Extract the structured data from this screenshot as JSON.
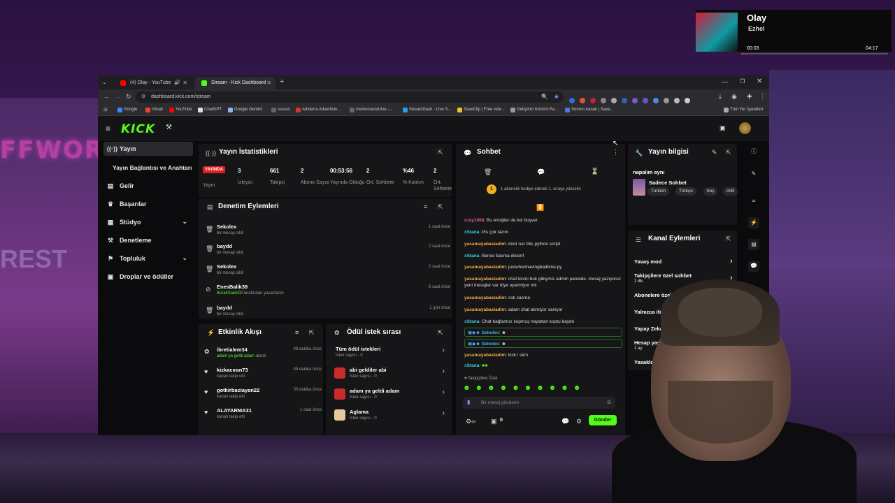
{
  "youtube_pip": {
    "title": "Olay",
    "artist": "Ezhel",
    "time_current": "00:03",
    "time_total": "04:17",
    "progress": 0.012
  },
  "browser": {
    "tabs": [
      {
        "label": "(4) Olay - YouTube",
        "active": false,
        "color": "#ff0000"
      },
      {
        "label": "Stream - Kick Dashboard",
        "active": true,
        "color": "#53fc18"
      }
    ],
    "url": "dashboard.kick.com/stream",
    "bookmarks": [
      "Google",
      "Gmail",
      "YouTube",
      "ChatGPT",
      "Google Gemini",
      "ssssss",
      "Adsterra Advertisin...",
      "memesound.live -...",
      "StreamDash - Live S...",
      "SaveClip | Free vide...",
      "Geliştirici Kontrol Pa...",
      "Sonrım kanalı | Save..."
    ],
    "bookmarks_all": "Tüm Yer İşaretleri"
  },
  "kick": {
    "logo": "KICK",
    "sidebar": [
      {
        "label": "Yayın",
        "icon": "broadcast-icon",
        "active": true
      },
      {
        "label": "Yayın Bağlantısı ve Anahtarı",
        "icon": "",
        "active": false
      },
      {
        "label": "Gelir",
        "icon": "wallet-icon",
        "active": false
      },
      {
        "label": "Başarılar",
        "icon": "trophy-icon",
        "active": false
      },
      {
        "label": "Stüdyo",
        "icon": "studio-icon",
        "active": false,
        "chevron": true
      },
      {
        "label": "Denetleme",
        "icon": "hammer-icon",
        "active": false
      },
      {
        "label": "Topluluk",
        "icon": "community-icon",
        "active": false,
        "chevron": true
      },
      {
        "label": "Droplar ve ödüller",
        "icon": "gift-icon",
        "active": false
      }
    ],
    "stats": {
      "title": "Yayın İstatistikleri",
      "live_badge": "YAYINDA",
      "items": [
        {
          "value": "",
          "label": "Yayın"
        },
        {
          "value": "3",
          "label": "İzleyici"
        },
        {
          "value": "661",
          "label": "Takipçi"
        },
        {
          "value": "2",
          "label": "Abone Sayısı"
        },
        {
          "value": "00:53:56",
          "label": "Yayında Olduğu"
        },
        {
          "value": "2",
          "label": "Ort. Sohbete"
        },
        {
          "value": "%46",
          "label": "% Katılım"
        },
        {
          "value": "2",
          "label": "Ort. Sohbete"
        }
      ]
    },
    "moderation": {
      "title": "Denetim Eylemleri",
      "rows": [
        {
          "name": "Sekolex",
          "sub": "bir mesajı sildi",
          "time": "1 saat önce",
          "icon": "trash-icon"
        },
        {
          "name": "baydd",
          "sub": "bir mesajı sildi",
          "time": "2 saat önce",
          "icon": "trash-icon"
        },
        {
          "name": "Sekolex",
          "sub": "bir mesajı sildi",
          "time": "2 saat önce",
          "icon": "trash-icon"
        },
        {
          "name": "EnesBalik39",
          "sub_user": "BurakSakinOl",
          "sub": "tarafından yasaklandı",
          "time": "6 saat önce",
          "icon": "ban-icon"
        },
        {
          "name": "baydd",
          "sub": "bir mesajı sildi",
          "time": "1 gün önce",
          "icon": "trash-icon"
        }
      ]
    },
    "activity": {
      "title": "Etkinlik Akışı",
      "rows": [
        {
          "name": "ibretialem34",
          "sub_hl": "adam ya geldi adam",
          "sub": "alındı",
          "time": "48 dakika önce",
          "icon": "reward-icon"
        },
        {
          "name": "kizkacıran73",
          "sub": "kanalı takip etti",
          "time": "49 dakika önce",
          "icon": "heart-icon"
        },
        {
          "name": "gotkirbaciayan22",
          "sub": "kanalı takip etti",
          "time": "50 dakika önce",
          "icon": "heart-icon"
        },
        {
          "name": "ALAYARMA31",
          "sub": "kanalı takip etti",
          "time": "1 saat önce",
          "icon": "heart-icon"
        }
      ]
    },
    "rewards": {
      "title": "Ödül istek sırası",
      "rows": [
        {
          "name": "Tüm ödül istekleri",
          "sub": "İstek sayısı - 0",
          "color": ""
        },
        {
          "name": "abi geldiler abi",
          "sub": "İstek sayısı - 0",
          "color": "#c92a2a"
        },
        {
          "name": "adam ya geldi adam",
          "sub": "İstek sayısı - 0",
          "color": "#c92a2a"
        },
        {
          "name": "Aglama",
          "sub": "İstek sayısı - 0",
          "color": "#e6c89a"
        }
      ]
    },
    "chat": {
      "title": "Sohbet",
      "gift_banner": "1 aboneilk hediye ederek 1. sıraya yükselin",
      "gift_rank": "1",
      "messages": [
        {
          "user": "rusy1968",
          "color": "#e25a8a",
          "text": "Bu emojiler de kel boşver"
        },
        {
          "user": "xStana",
          "color": "#3ad1e0",
          "text": "Pis çok lazım"
        },
        {
          "user": "yasamayabasladim",
          "color": "#f0b040",
          "text": "dont run this python script"
        },
        {
          "user": "xStana",
          "color": "#3ad1e0",
          "text": "Bence basma diksmf"
        },
        {
          "user": "yasamayabasladim",
          "color": "#f0b040",
          "text": "justwhenhavingbadtime.py"
        },
        {
          "user": "yasamayabasladim",
          "color": "#f0b040",
          "text": "chat kismi bok gibiymis admin panelde. mesaj yaziyoruz yeni mesajlar var diye uyarmiyor mk"
        },
        {
          "user": "yasamayabasladim",
          "color": "#f0b040",
          "text": "cok sacma"
        },
        {
          "user": "yasamayabasladim",
          "color": "#f0b040",
          "text": "adam chat akmiyor saniyor"
        },
        {
          "user": "xStana",
          "color": "#3ad1e0",
          "text": "Chat bağlantısı kopmuş hayattan koptu baydo"
        },
        {
          "user": "Sekolex",
          "color": "#3ab0ff",
          "text": ""
        },
        {
          "user": "Sekolex",
          "color": "#3ab0ff",
          "text": ""
        },
        {
          "user": "yasamayabasladim",
          "color": "#f0b040",
          "text": "kick i skm"
        },
        {
          "user": "xStana",
          "color": "#3ad1e0",
          "text": ""
        }
      ],
      "followers_only": "Takipçilere Özel",
      "input_placeholder": "Bir mesaj gönderin",
      "count": "0",
      "send_label": "Gönder"
    },
    "stream_info": {
      "title": "Yayın bilgisi",
      "stream_title": "napalım aynı",
      "category": "Sadece Sohbet",
      "tags": [
        "Turkish",
        "Türkçe",
        "boş",
        "chill"
      ]
    },
    "channel_actions": {
      "title": "Kanal Eylemleri",
      "rows": [
        {
          "label": "Yavaş mod",
          "sub": "",
          "chevron": true
        },
        {
          "label": "Takipçilere özel sohbet",
          "sub": "1 dk.",
          "chevron": true
        },
        {
          "label": "Abonelere özel sohbet",
          "sub": "",
          "toggle": true
        },
        {
          "label": "Yalnızca ifadelerle sohbet",
          "sub": "",
          "toggle": true
        },
        {
          "label": "Yapay Zeka ile Sohbet Denetimi",
          "sub": ""
        },
        {
          "label": "Hesap yaşı kısıtlaması",
          "sub": "1 ay"
        },
        {
          "label": "Yasaklanmış kelimeler",
          "sub": ""
        }
      ]
    }
  }
}
